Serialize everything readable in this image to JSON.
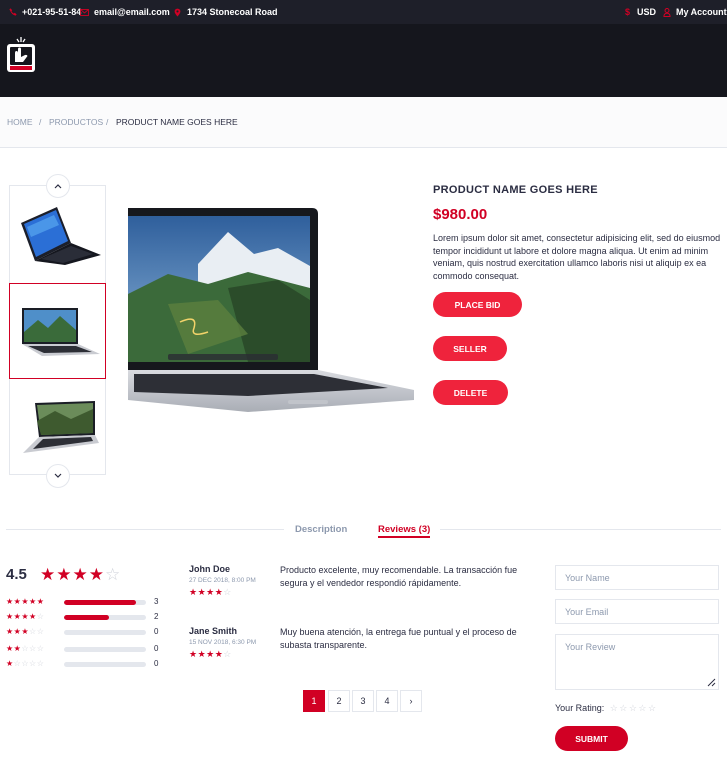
{
  "topbar": {
    "phone": "+021-95-51-84",
    "email": "email@email.com",
    "address": "1734 Stonecoal Road",
    "currency": "USD",
    "account": "My Account",
    "icons": {
      "phone": "phone-icon",
      "email": "envelope-icon",
      "address": "map-marker-icon",
      "currency": "dollar-icon",
      "account": "user-icon"
    }
  },
  "breadcrumb": {
    "items": [
      "HOME",
      "PRODUCTOS",
      "PRODUCT NAME GOES HERE"
    ],
    "separator": "/"
  },
  "product": {
    "name": "PRODUCT NAME GOES HERE",
    "price": "$980.00",
    "description": "Lorem ipsum dolor sit amet, consectetur adipisicing elit, sed do eiusmod tempor incididunt ut labore et dolore magna aliqua. Ut enim ad minim veniam, quis nostrud exercitation ullamco laboris nisi ut aliquip ex ea commodo consequat.",
    "buttons": {
      "place_bid": "PLACE BID",
      "seller": "SELLER",
      "delete": "DELETE"
    }
  },
  "tabs": {
    "description": "Description",
    "reviews": "Reviews (3)",
    "active": "reviews"
  },
  "rating": {
    "average": "4.5",
    "average_stars": 4,
    "breakdown": [
      {
        "stars": 5,
        "count": "3",
        "fill": 0.88
      },
      {
        "stars": 4,
        "count": "2",
        "fill": 0.55
      },
      {
        "stars": 3,
        "count": "0",
        "fill": 0
      },
      {
        "stars": 2,
        "count": "0",
        "fill": 0
      },
      {
        "stars": 1,
        "count": "0",
        "fill": 0
      }
    ]
  },
  "reviews": [
    {
      "author": "John Doe",
      "date": "27 DEC 2018, 8:00 PM",
      "stars": 4,
      "text": "Producto excelente, muy recomendable. La transacción fue segura y el vendedor respondió rápidamente."
    },
    {
      "author": "Jane Smith",
      "date": "15 NOV 2018, 6:30 PM",
      "stars": 4,
      "text": "Muy buena atención, la entrega fue puntual y el proceso de subasta transparente."
    }
  ],
  "pagination": {
    "pages": [
      "1",
      "2",
      "3",
      "4"
    ],
    "active": "1",
    "next": "›"
  },
  "form": {
    "name_placeholder": "Your Name",
    "email_placeholder": "Your Email",
    "review_placeholder": "Your Review",
    "rating_label": "Your Rating:",
    "submit": "SUBMIT"
  },
  "colors": {
    "accent": "#d10024",
    "button": "#ef233c",
    "dark": "#15161d",
    "topbar": "#1e1f29",
    "text": "#2b2d42",
    "muted": "#8d99ae"
  }
}
